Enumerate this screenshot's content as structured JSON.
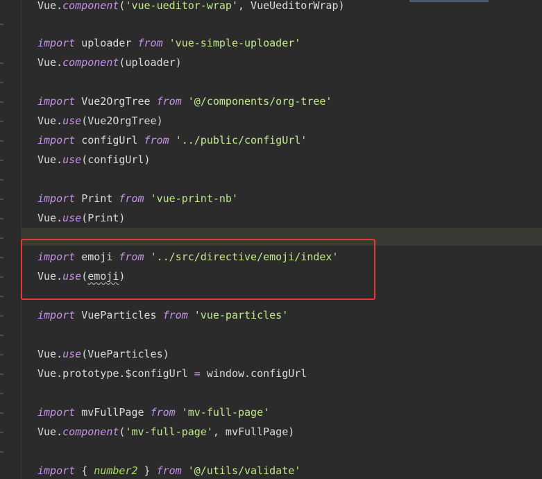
{
  "editor": {
    "lines": [
      {
        "kw": "",
        "pre": "Vue.",
        "call": "component",
        "args_open": "(",
        "str": "'vue-ueditor-wrap'",
        "tail": ", VueUeditorWrap)"
      },
      {
        "kw": "import",
        "name": " uploader ",
        "from": "from",
        "str": "'vue-simple-uploader'"
      },
      {
        "kw": "",
        "pre": "Vue.",
        "call": "component",
        "args_open": "(",
        "str": "",
        "tail": "uploader)"
      },
      {
        "kw": "import",
        "name": " Vue2OrgTree ",
        "from": "from",
        "str": "'@/components/org-tree'"
      },
      {
        "kw": "",
        "pre": "Vue.",
        "call": "use",
        "args_open": "(",
        "str": "",
        "tail": "Vue2OrgTree)"
      },
      {
        "kw": "import",
        "name": " configUrl ",
        "from": "from",
        "str": "'../public/configUrl'"
      },
      {
        "kw": "",
        "pre": "Vue.",
        "call": "use",
        "args_open": "(",
        "str": "",
        "tail": "configUrl)"
      },
      {
        "kw": "import",
        "name": " Print ",
        "from": "from",
        "str": "'vue-print-nb'"
      },
      {
        "kw": "",
        "pre": "Vue.",
        "call": "use",
        "args_open": "(",
        "str": "",
        "tail": "Print)"
      },
      {
        "kw": "import",
        "name": " emoji ",
        "from": "from",
        "str": "'../src/directive/emoji/index'"
      },
      {
        "kw": "",
        "pre": "Vue.",
        "call": "use",
        "args_open": "(",
        "str": "",
        "tail_squiggle": "emoji",
        "tail": ")"
      },
      {
        "kw": "import",
        "name": " VueParticles ",
        "from": "from",
        "str": "'vue-particles'"
      },
      {
        "kw": "",
        "pre": "Vue.",
        "call": "use",
        "args_open": "(",
        "str": "",
        "tail": "VueParticles)"
      },
      {
        "kw": "",
        "pre": "Vue.prototype.$configUrl ",
        "op": "=",
        "tail": " window.configUrl"
      },
      {
        "kw": "import",
        "name": " mvFullPage ",
        "from": "from",
        "str": "'mv-full-page'"
      },
      {
        "kw": "",
        "pre": "Vue.",
        "call": "component",
        "args_open": "(",
        "str": "'mv-full-page'",
        "tail": ", mvFullPage)"
      },
      {
        "kw": "import",
        "name": " { ",
        "fn2": "number2",
        "name2": " } ",
        "from": "from",
        "str": "'@/utils/validate'"
      }
    ]
  },
  "colors": {
    "background": "#2b2b2b",
    "keyword": "#c792ea",
    "string": "#c3e88d",
    "identifier": "#dcdcdc",
    "highlight_box": "#e53935",
    "current_line": "#383a33"
  }
}
